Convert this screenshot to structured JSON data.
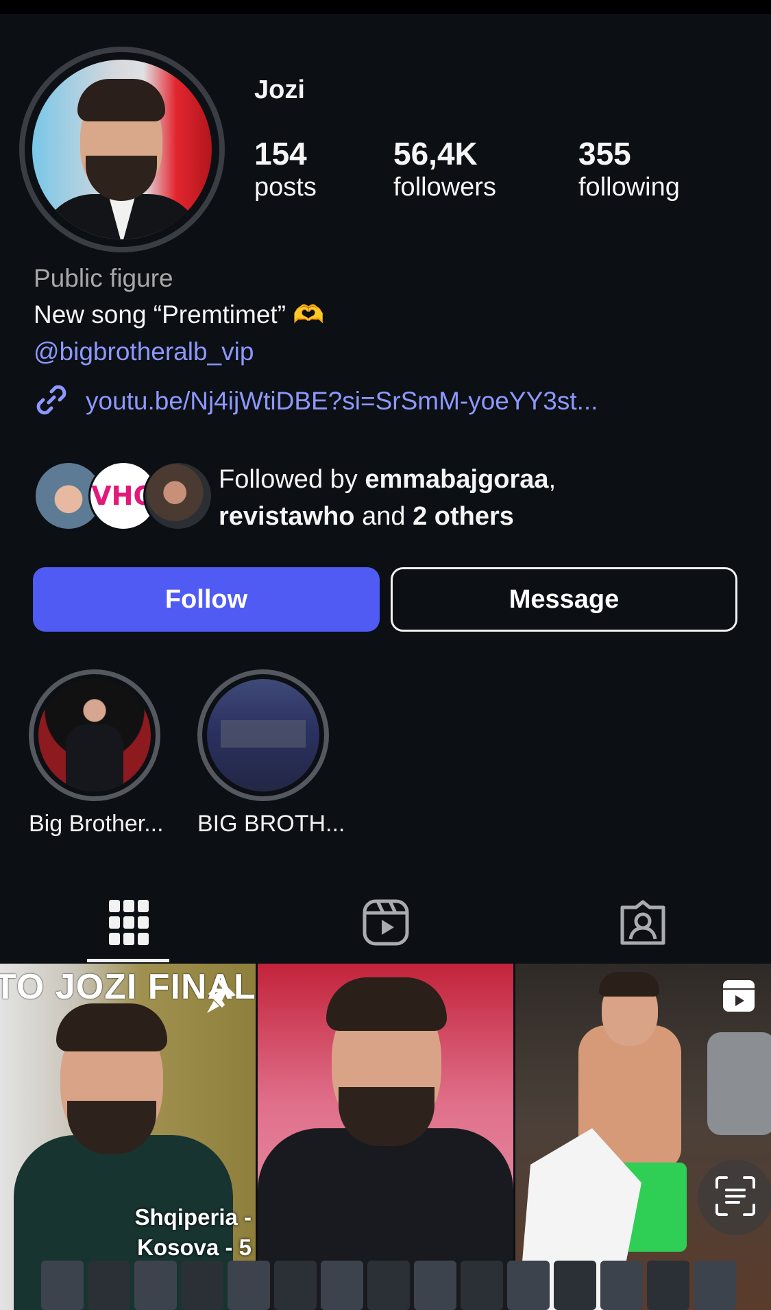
{
  "profile": {
    "username": "Jozi",
    "stats": [
      {
        "value": "154",
        "label": "posts"
      },
      {
        "value": "56,4K",
        "label": "followers"
      },
      {
        "value": "355",
        "label": "following"
      }
    ],
    "category": "Public figure",
    "bio": "New song “Premtimet” 🫶",
    "mention": "@bigbrotheralb_vip",
    "link": "youtu.be/Nj4ijWtiDBE?si=SrSmM-yoeYY3st..."
  },
  "followed_by": {
    "prefix": "Followed by ",
    "user1": "emmabajgoraa",
    "comma": ",",
    "user2": "revistawho",
    "middle": " and ",
    "others": "2 others",
    "avatar2_text": "VHO"
  },
  "buttons": {
    "follow": "Follow",
    "message": "Message"
  },
  "highlights": [
    {
      "label": "Big Brother..."
    },
    {
      "label": "BIG BROTH..."
    }
  ],
  "tabs": {
    "icons": [
      "grid-icon",
      "reels-icon",
      "tagged-icon"
    ],
    "active": "grid-icon"
  },
  "grid": {
    "post1_title": "TO JOZI FINALI",
    "post1_caption_line1": "Shqiperia -",
    "post1_caption_line2": "Kosova - 5"
  },
  "colors": {
    "background": "#0c0f14",
    "accent": "#4f5bf2",
    "link": "#8d98ff"
  }
}
